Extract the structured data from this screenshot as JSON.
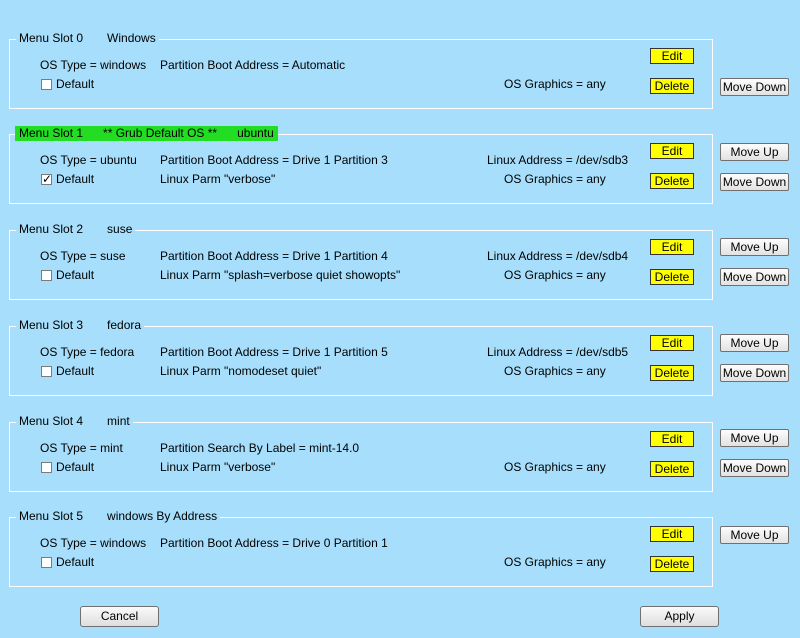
{
  "labels": {
    "os_type_prefix": "OS Type = ",
    "default": "Default",
    "os_graphics": "OS Graphics = any",
    "edit": "Edit",
    "delete": "Delete",
    "move_up": "Move Up",
    "move_down": "Move Down"
  },
  "slots": [
    {
      "slot": "Menu Slot 0",
      "name": "Windows",
      "os_type": "OS Type = windows",
      "boot": "Partition Boot Address = Automatic",
      "default_checked": false
    },
    {
      "slot": "Menu Slot 1",
      "grub_default": "** Grub Default OS **",
      "name": "ubuntu",
      "os_type": "OS Type = ubuntu",
      "boot": "Partition Boot Address = Drive  1  Partition 3",
      "linux_address": "Linux Address  =  /dev/sdb3",
      "linux_parm": "Linux Parm  \"verbose\"",
      "default_checked": true
    },
    {
      "slot": "Menu Slot 2",
      "name": "suse",
      "os_type": "OS Type = suse",
      "boot": "Partition Boot Address = Drive  1  Partition 4",
      "linux_address": "Linux Address  =  /dev/sdb4",
      "linux_parm": "Linux Parm  \"splash=verbose quiet showopts\"",
      "default_checked": false
    },
    {
      "slot": "Menu Slot 3",
      "name": "fedora",
      "os_type": "OS Type = fedora",
      "boot": "Partition Boot Address = Drive  1  Partition 5",
      "linux_address": "Linux Address  =  /dev/sdb5",
      "linux_parm": "Linux Parm  \"nomodeset quiet\"",
      "default_checked": false
    },
    {
      "slot": "Menu Slot 4",
      "name": "mint",
      "os_type": "OS Type = mint",
      "boot": "Partition Search By Label = mint-14.0",
      "linux_parm": "Linux Parm  \"verbose\"",
      "default_checked": false
    },
    {
      "slot": "Menu Slot 5",
      "name": "windows By Address",
      "os_type": "OS Type = windows",
      "boot": "Partition Boot Address = Drive  0  Partition 1",
      "default_checked": false
    }
  ],
  "footer": {
    "cancel": "Cancel",
    "apply": "Apply"
  },
  "colors": {
    "background": "#a6defc",
    "default_highlight": "#22dd22",
    "action_button": "#ffff00"
  }
}
